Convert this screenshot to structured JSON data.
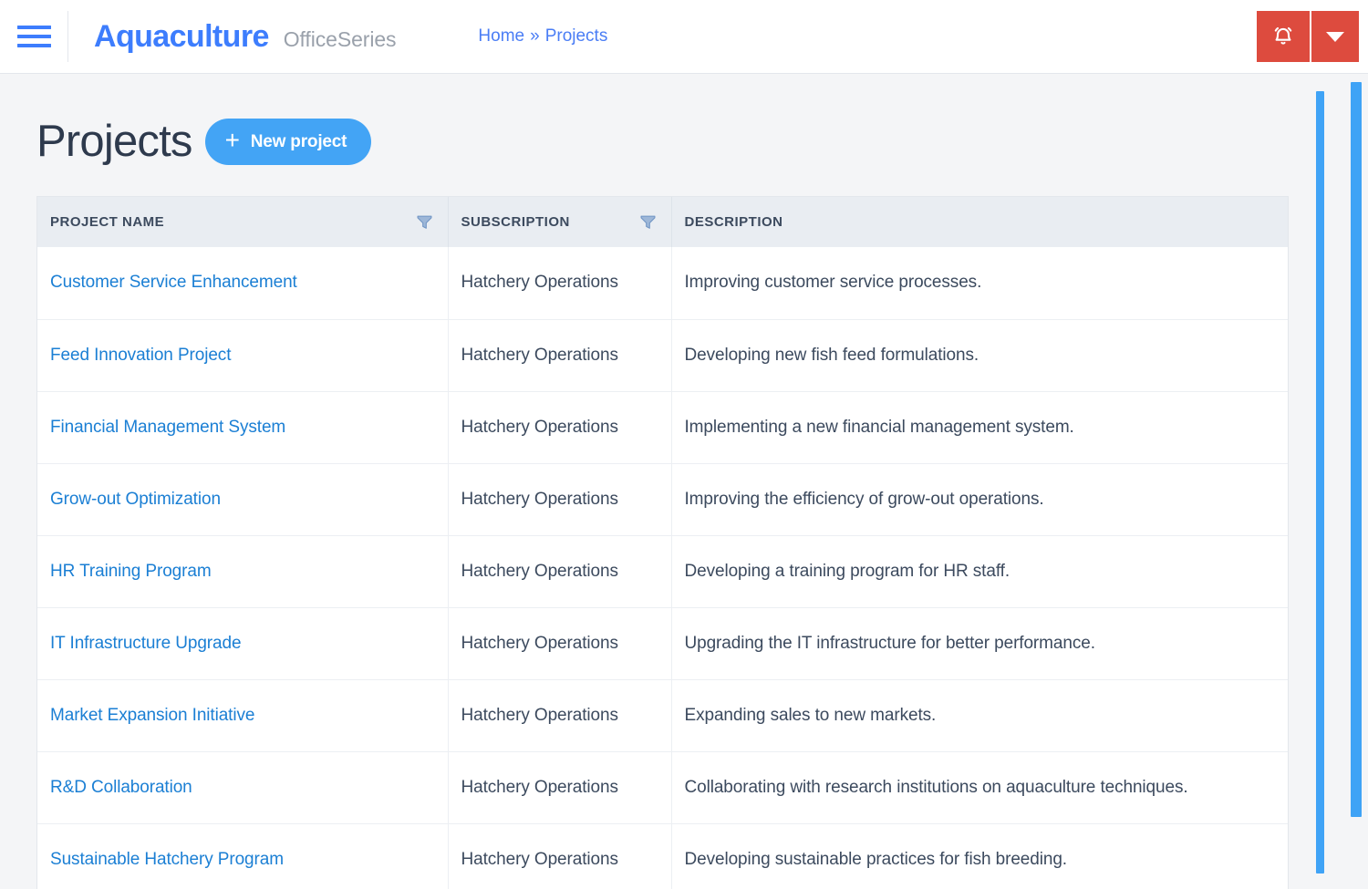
{
  "header": {
    "menu_icon": "hamburger-icon",
    "brand_name": "Aquaculture",
    "brand_suffix": "OfficeSeries",
    "breadcrumb": {
      "home": "Home",
      "separator": "»",
      "current": "Projects"
    },
    "notification_icon": "bell-icon",
    "dropdown_icon": "caret-down-icon",
    "accent_red": "#dd4b3e",
    "accent_blue": "#3d7dfd"
  },
  "page": {
    "title": "Projects",
    "new_project_button": "New project",
    "new_project_icon": "plus-icon",
    "new_project_color": "#43a4f5"
  },
  "table": {
    "columns": [
      {
        "label": "PROJECT NAME",
        "filter_icon": "filter-funnel-icon",
        "has_filter": true
      },
      {
        "label": "SUBSCRIPTION",
        "filter_icon": "filter-funnel-icon",
        "has_filter": true
      },
      {
        "label": "DESCRIPTION",
        "filter_icon": "",
        "has_filter": false
      }
    ],
    "rows": [
      {
        "name": "Customer Service Enhancement",
        "subscription": "Hatchery Operations",
        "description": "Improving customer service processes."
      },
      {
        "name": "Feed Innovation Project",
        "subscription": "Hatchery Operations",
        "description": "Developing new fish feed formulations."
      },
      {
        "name": "Financial Management System",
        "subscription": "Hatchery Operations",
        "description": "Implementing a new financial management system."
      },
      {
        "name": "Grow-out Optimization",
        "subscription": "Hatchery Operations",
        "description": "Improving the efficiency of grow-out operations."
      },
      {
        "name": "HR Training Program",
        "subscription": "Hatchery Operations",
        "description": "Developing a training program for HR staff."
      },
      {
        "name": "IT Infrastructure Upgrade",
        "subscription": "Hatchery Operations",
        "description": "Upgrading the IT infrastructure for better performance."
      },
      {
        "name": "Market Expansion Initiative",
        "subscription": "Hatchery Operations",
        "description": "Expanding sales to new markets."
      },
      {
        "name": "R&D Collaboration",
        "subscription": "Hatchery Operations",
        "description": "Collaborating with research institutions on aquaculture techniques."
      },
      {
        "name": "Sustainable Hatchery Program",
        "subscription": "Hatchery Operations",
        "description": "Developing sustainable practices for fish breeding."
      }
    ]
  },
  "scrollbars": {
    "inner_color": "#3fa3f6",
    "outer_color": "#3fa3f6"
  }
}
